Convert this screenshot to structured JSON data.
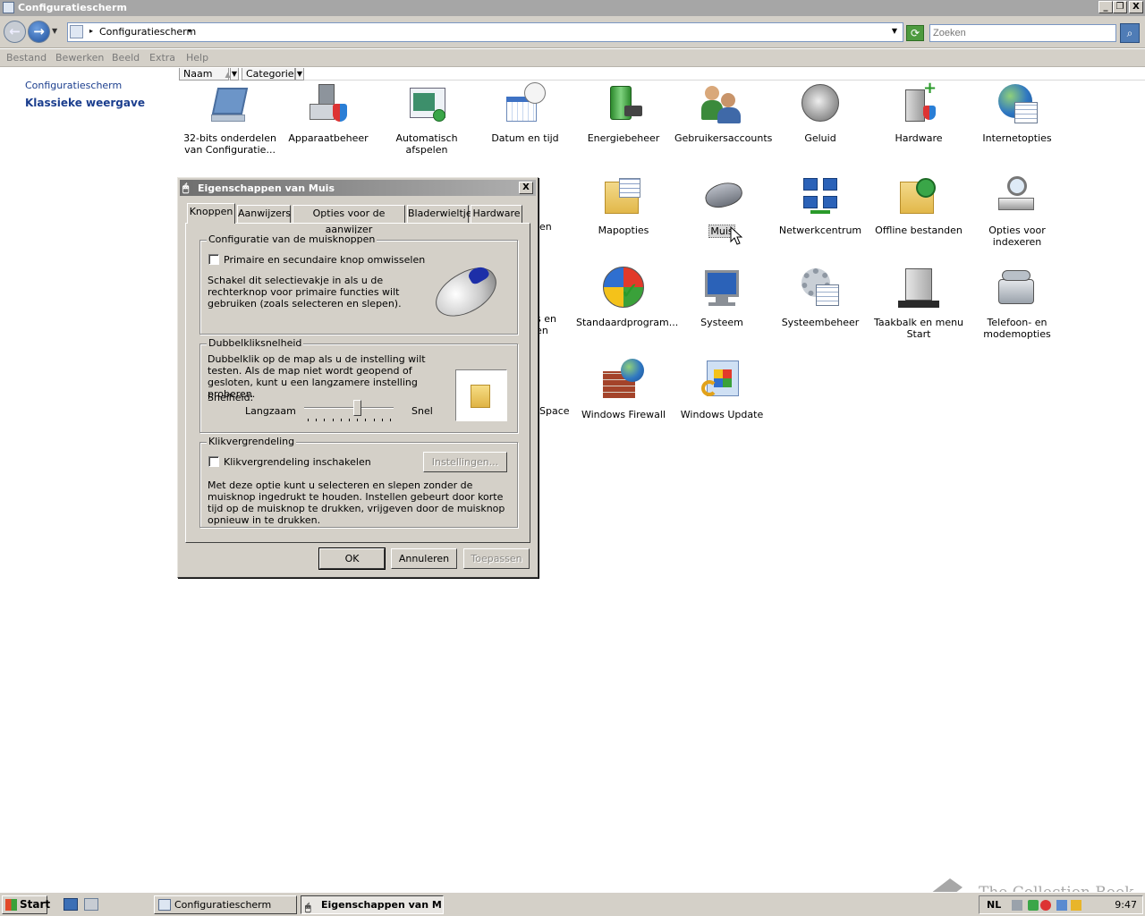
{
  "window": {
    "title": "Configuratiescherm",
    "buttons": {
      "minimize": "_",
      "restore": "❐",
      "close": "X"
    }
  },
  "address": {
    "crumb": "Configuratiescherm",
    "search_placeholder": "Zoeken"
  },
  "menu": [
    "Bestand",
    "Bewerken",
    "Beeld",
    "Extra",
    "Help"
  ],
  "leftpane": {
    "link_home": "Configuratiescherm",
    "link_classic": "Klassieke weergave"
  },
  "columns": {
    "name": "Naam",
    "category": "Categorie"
  },
  "items": {
    "i32bit": "32-bits onderdelen van Configuratie...",
    "apparaat": "Apparaatbeheer",
    "autoplay": "Automatisch afspelen",
    "datum": "Datum en tijd",
    "energie": "Energiebeheer",
    "gebruikers": "Gebruikersaccounts",
    "geluid": "Geluid",
    "hardware": "Hardware",
    "internet": "Internetopties",
    "mapopties": "Mapopties",
    "muis": "Muis",
    "netwerk": "Netwerkcentrum",
    "offline": "Offline bestanden",
    "indexeren": "Opties voor indexeren",
    "standaard": "Standaardprogram...",
    "systeem": "Systeem",
    "systeembeheer": "Systeembeheer",
    "taakbalk": "Taakbalk en menu Start",
    "telefoon": "Telefoon- en modemopties",
    "firewall": "Windows Firewall",
    "update": "Windows Update",
    "partial_pen": "pen",
    "partial_sen": "'s en",
    "partial_len": "len",
    "partial_dspace": "dSpace"
  },
  "dialog": {
    "title": "Eigenschappen van Muis",
    "close": "X",
    "tabs": [
      "Knoppen",
      "Aanwijzers",
      "Opties voor de aanwijzer",
      "Bladerwieltje",
      "Hardware"
    ],
    "group1": {
      "legend": "Configuratie van de muisknoppen",
      "checkbox": "Primaire en secundaire knop omwisselen",
      "desc": "Schakel dit selectievakje in als u de rechterknop voor primaire functies wilt gebruiken (zoals selecteren en slepen)."
    },
    "group2": {
      "legend": "Dubbelkliksnelheid",
      "desc": "Dubbelklik op de map als u de instelling wilt testen. Als de map niet wordt geopend of gesloten, kunt u een langzamere instelling proberen.",
      "speed_label": "Snelheid:",
      "slow": "Langzaam",
      "fast": "Snel",
      "speed_value": 0.6
    },
    "group3": {
      "legend": "Klikvergrendeling",
      "checkbox": "Klikvergrendeling inschakelen",
      "settings": "Instellingen...",
      "desc": "Met deze optie kunt u selecteren en slepen zonder de muisknop ingedrukt te houden. Instellen gebeurt door korte tijd op de muisknop te drukken, vrijgeven door de muisknop opnieuw in te drukken."
    },
    "ok": "OK",
    "cancel": "Annuleren",
    "apply": "Toepassen"
  },
  "taskbar": {
    "start": "Start",
    "task1": "Configuratiescherm",
    "task2": "Eigenschappen van M...",
    "lang": "NL",
    "clock": "9:47"
  },
  "watermark": "The Collection Book"
}
